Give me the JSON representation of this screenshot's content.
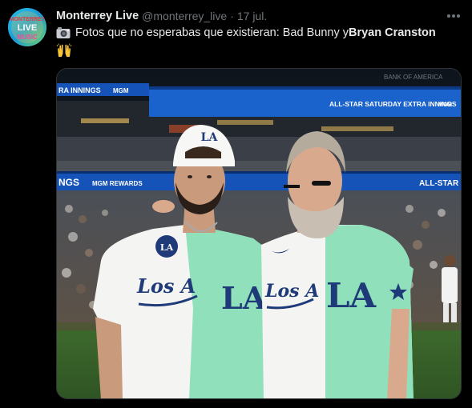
{
  "author": {
    "name": "Monterrey Live",
    "handle": "@monterrey_live",
    "date": "17 jul.",
    "avatar_logo_lines": [
      "MONTERREY",
      "LIVE",
      "MUSIC"
    ]
  },
  "tweet": {
    "text_plain": "Fotos que no esperabas que existieran: Bad Bunny y ",
    "text_bold": "Bryan Cranston",
    "leading_icon": "camera-icon",
    "trailing_icon": "raised-hands-icon"
  },
  "photo": {
    "banner_upper_left": "RA INNINGS",
    "banner_upper_left_brand": "MGM",
    "banner_upper_right": "ALL-STAR SATURDAY EXTRA INNINGS",
    "banner_upper_right_brand": "MGM",
    "banner_top_far_right": "BANK OF AMERICA",
    "banner_lower_left": "NGS",
    "banner_lower_left_brand": "MGM REWARDS",
    "banner_lower_right": "ALL-STAR",
    "jersey_left_script": "Los A",
    "jersey_left_logo": "LA",
    "jersey_right_script": "Los A",
    "jersey_right_logo": "LA",
    "cap_logo": "LA",
    "patch_logo": "LA"
  },
  "colors": {
    "background": "#000000",
    "primary_text": "#e7e9ea",
    "secondary_text": "#71767b",
    "jersey_mint": "#8fe0bb",
    "jersey_white": "#f4f4f2",
    "dodger_blue": "#1e3a78",
    "banner_blue": "#1553b8"
  }
}
